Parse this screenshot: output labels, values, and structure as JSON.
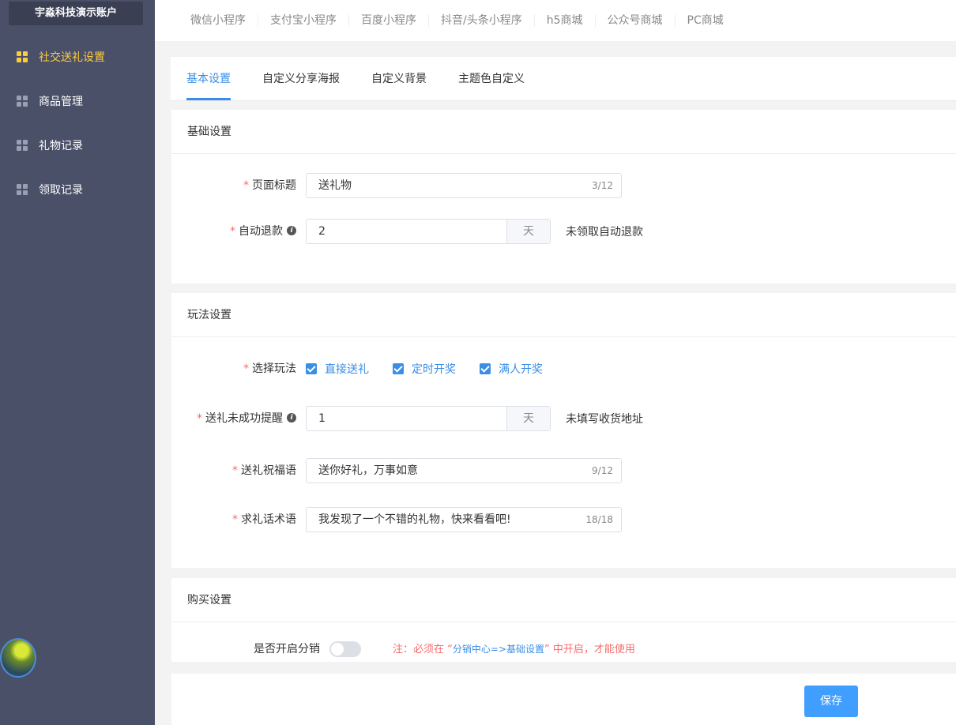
{
  "sidebar": {
    "account": "宇淼科技演示账户",
    "items": [
      {
        "label": "社交送礼设置",
        "active": true
      },
      {
        "label": "商品管理"
      },
      {
        "label": "礼物记录"
      },
      {
        "label": "领取记录"
      }
    ]
  },
  "topnav": [
    "微信小程序",
    "支付宝小程序",
    "百度小程序",
    "抖音/头条小程序",
    "h5商城",
    "公众号商城",
    "PC商城"
  ],
  "tabs": [
    "基本设置",
    "自定义分享海报",
    "自定义背景",
    "主题色自定义"
  ],
  "basic": {
    "title": "基础设置",
    "page_title_label": "页面标题",
    "page_title_value": "送礼物",
    "page_title_count": "3/12",
    "refund_label": "自动退款",
    "refund_value": "2",
    "refund_unit": "天",
    "refund_tip": "未领取自动退款"
  },
  "play": {
    "title": "玩法设置",
    "mode_label": "选择玩法",
    "modes": [
      "直接送礼",
      "定时开奖",
      "满人开奖"
    ],
    "fail_label": "送礼未成功提醒",
    "fail_value": "1",
    "fail_unit": "天",
    "fail_tip": "未填写收货地址",
    "blessing_label": "送礼祝福语",
    "blessing_value": "送你好礼，万事如意",
    "blessing_count": "9/12",
    "ask_label": "求礼话术语",
    "ask_value": "我发现了一个不错的礼物，快来看看吧!",
    "ask_count": "18/18"
  },
  "buy": {
    "title": "购买设置",
    "dist_label": "是否开启分销",
    "dist_enabled": false,
    "note_prefix": "注：必须在 “",
    "note_link": "分销中心=>基础设置",
    "note_suffix": "” 中开启，才能使用"
  },
  "save_label": "保存",
  "colors": {
    "sidebar": "#4a5068",
    "accent": "#409eff",
    "active": "#fecb3e",
    "required": "#f56c6c"
  }
}
